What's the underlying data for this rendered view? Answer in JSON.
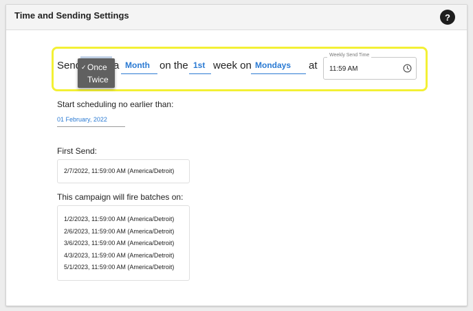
{
  "header": {
    "title": "Time and Sending Settings",
    "help_label": "?"
  },
  "schedule": {
    "send_label": "Send",
    "a_label": "a",
    "frequency_options": [
      {
        "label": "Once",
        "checked": true,
        "check_mark": "✓"
      },
      {
        "label": "Twice",
        "checked": false
      }
    ],
    "period_value": "Month",
    "on_the_label": "on the",
    "week_value": "1st",
    "week_on_label": "week on",
    "day_value": "Mondays",
    "at_label": "at",
    "time_field": {
      "label": "Weekly Send Time",
      "value": "11:59 AM",
      "icon": "clock-icon"
    }
  },
  "start": {
    "label": "Start scheduling no earlier than:",
    "value": "01 February, 2022"
  },
  "first_send": {
    "label": "First Send:",
    "value": "2/7/2022, 11:59:00 AM (America/Detroit)"
  },
  "batches": {
    "label": "This campaign will fire batches on:",
    "items": [
      "1/2/2023, 11:59:00 AM (America/Detroit)",
      "2/6/2023, 11:59:00 AM (America/Detroit)",
      "3/6/2023, 11:59:00 AM (America/Detroit)",
      "4/3/2023, 11:59:00 AM (America/Detroit)",
      "5/1/2023, 11:59:00 AM (America/Detroit)"
    ]
  },
  "colors": {
    "accent": "#2a7ad3",
    "highlight": "#f3f034",
    "dropdown_bg": "#606060"
  }
}
